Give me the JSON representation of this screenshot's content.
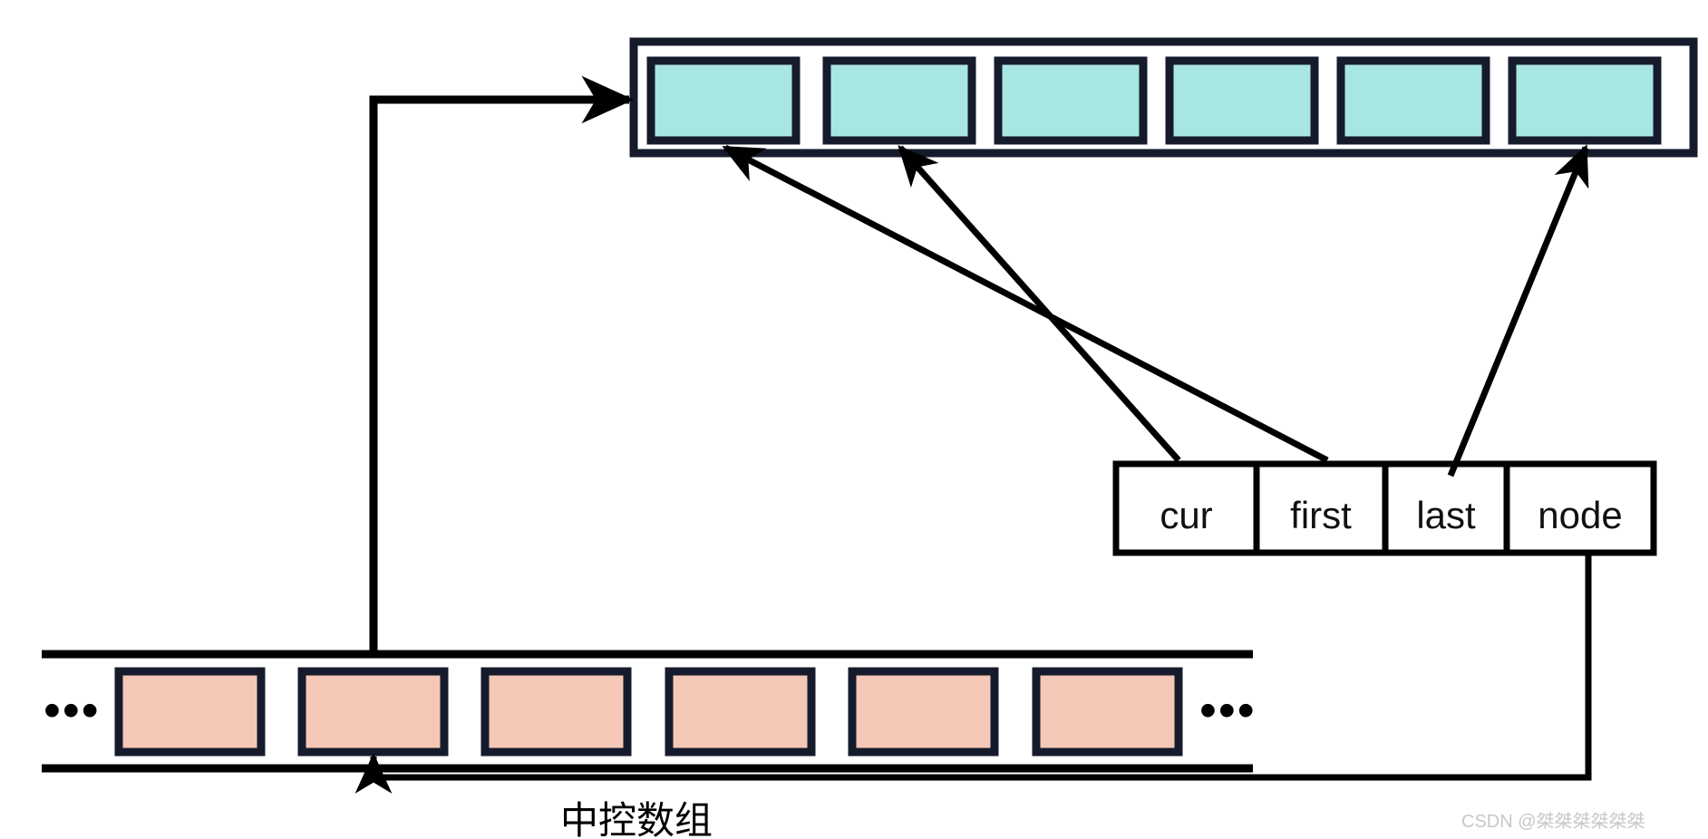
{
  "diagram": {
    "title": "deque-internal-structure",
    "caption": "中控数组",
    "watermark": "CSDN @桀桀桀桀桀桀",
    "colors": {
      "buffer_fill": "#a8e6e2",
      "map_fill": "#f4c7b6",
      "stroke_dark": "#161b2c",
      "stroke_black": "#000000",
      "background": "#ffffff",
      "watermark": "#c8c8c8"
    }
  },
  "buffer_array": {
    "name": "buffer",
    "cell_count": 6,
    "cells": [
      {
        "index": 0,
        "label": ""
      },
      {
        "index": 1,
        "label": ""
      },
      {
        "index": 2,
        "label": ""
      },
      {
        "index": 3,
        "label": ""
      },
      {
        "index": 4,
        "label": ""
      },
      {
        "index": 5,
        "label": ""
      }
    ]
  },
  "iterator_struct": {
    "name": "deque-iterator",
    "fields": [
      {
        "key": "cur",
        "label": "cur"
      },
      {
        "key": "first",
        "label": "first"
      },
      {
        "key": "last",
        "label": "last"
      },
      {
        "key": "node",
        "label": "node"
      }
    ]
  },
  "map_array": {
    "name": "map",
    "caption": "中控数组",
    "leading_ellipsis": "•••",
    "trailing_ellipsis": "•••",
    "cell_count": 6,
    "cells": [
      {
        "index": 0,
        "label": ""
      },
      {
        "index": 1,
        "label": ""
      },
      {
        "index": 2,
        "label": ""
      },
      {
        "index": 3,
        "label": ""
      },
      {
        "index": 4,
        "label": ""
      },
      {
        "index": 5,
        "label": ""
      }
    ]
  },
  "arrows": [
    {
      "id": "map-to-buffer",
      "from": "map.cells.1",
      "to": "buffer",
      "style": "elbow"
    },
    {
      "id": "cur-to-buffer-cell-1",
      "from": "iterator.cur",
      "to": "buffer.cells.1",
      "style": "diagonal"
    },
    {
      "id": "first-to-buffer-cell-0",
      "from": "iterator.first",
      "to": "buffer.cells.0",
      "style": "diagonal"
    },
    {
      "id": "last-to-buffer-cell-5",
      "from": "iterator.last",
      "to": "buffer.cells.5",
      "style": "diagonal"
    },
    {
      "id": "node-to-map-cell-1",
      "from": "iterator.node",
      "to": "map.cells.1",
      "style": "elbow"
    }
  ]
}
